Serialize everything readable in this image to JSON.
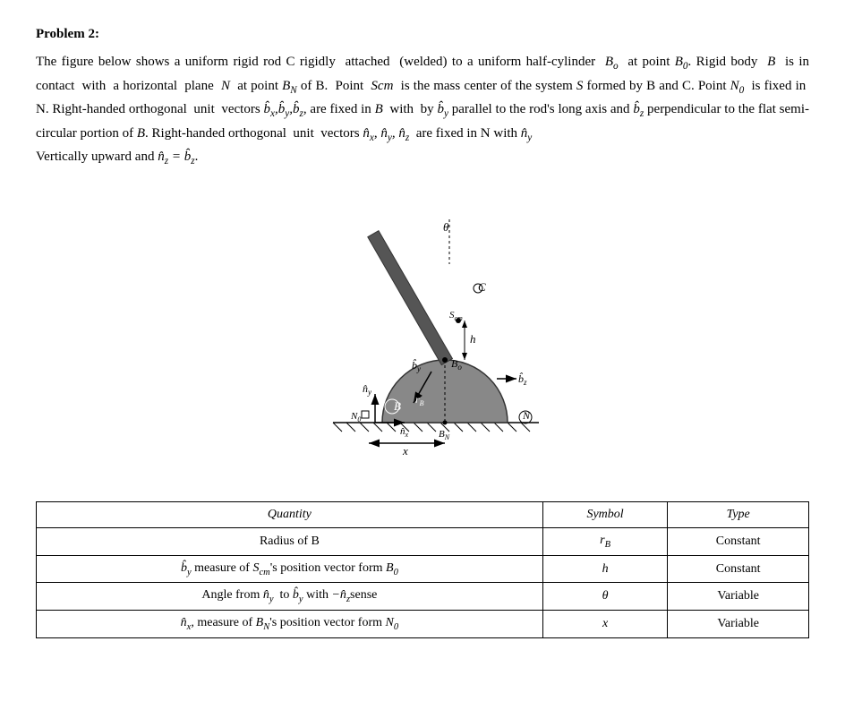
{
  "problem": {
    "title": "Problem 2:",
    "paragraph1": "The figure below shows a uniform rigid rod C rigidly attached (welded) to a uniform half-cylinder B",
    "paragraph_full": "The figure below shows a uniform rigid rod C rigidly attached (welded) to a uniform half-cylinder B₀ at point B₀. Rigid body B is in contact with a horizontal plane N at point B_N of B. Point Scm is the mass center of the system S formed by B and C. Point N₀ is fixed in N. Right-handed orthogonal unit vectors b̂_x, b̂_y, b̂_z, are fixed in B with by b̂_y parallel to the rod's long axis and b̂_z perpendicular to the flat semi-circular portion of B. Right-handed orthogonal unit vectors n̂_x, n̂_y, n̂_z are fixed in N with n̂_y Vertically upward and n̂_z = b̂_z.",
    "table": {
      "header": {
        "quantity": "Quantity",
        "symbol": "Symbol",
        "type": "Type"
      },
      "rows": [
        {
          "quantity": "Radius of B",
          "symbol": "r_B",
          "type": "Constant"
        },
        {
          "quantity": "b̂_y measure of S_cm's position vector form B₀",
          "symbol": "h",
          "type": "Constant"
        },
        {
          "quantity": "Angle from n̂_y to b̂_y with −n̂_z sense",
          "symbol": "θ",
          "type": "Variable"
        },
        {
          "quantity": "n̂_x, measure of B_N's position vector form N₀",
          "symbol": "x",
          "type": "Variable"
        }
      ]
    }
  }
}
